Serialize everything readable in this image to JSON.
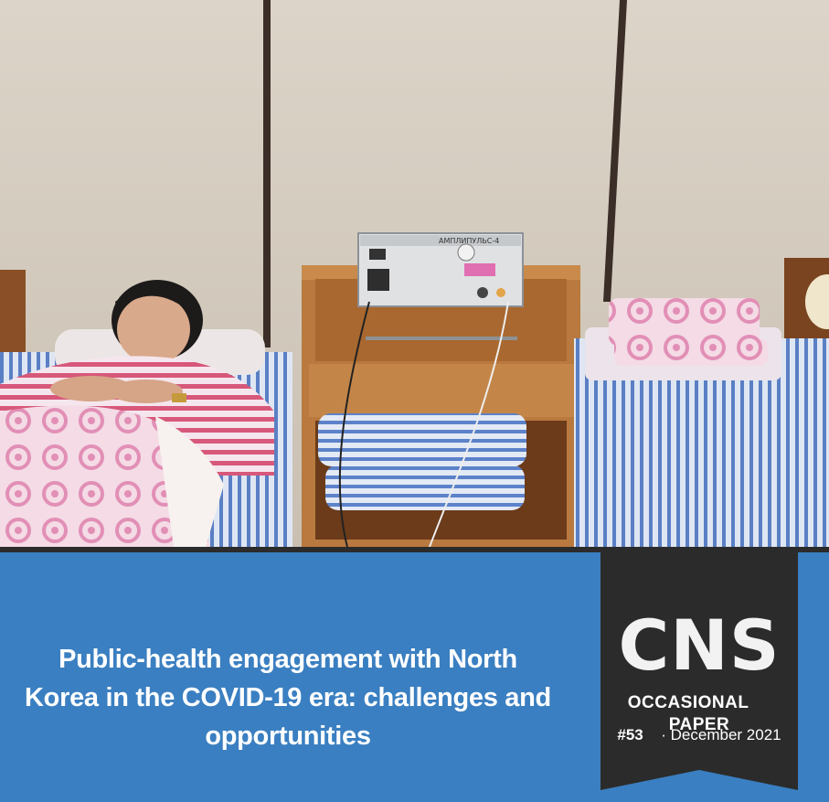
{
  "cover": {
    "photo_alt": "Photo",
    "title": "Public-health engagement with North Korea in the COVID-19 era: challenges and opportunities",
    "badge": {
      "org": "CNS",
      "series_word1": "OCCASIONAL",
      "series_word2": "PAPER",
      "number": "#53",
      "separator": "·",
      "date": "December 2021"
    },
    "device_label": "АМПЛИПУЛЬС-4"
  },
  "colors": {
    "band_blue": "#3a7fc1",
    "badge_dark": "#2b2b2b",
    "text_white": "#ffffff"
  }
}
